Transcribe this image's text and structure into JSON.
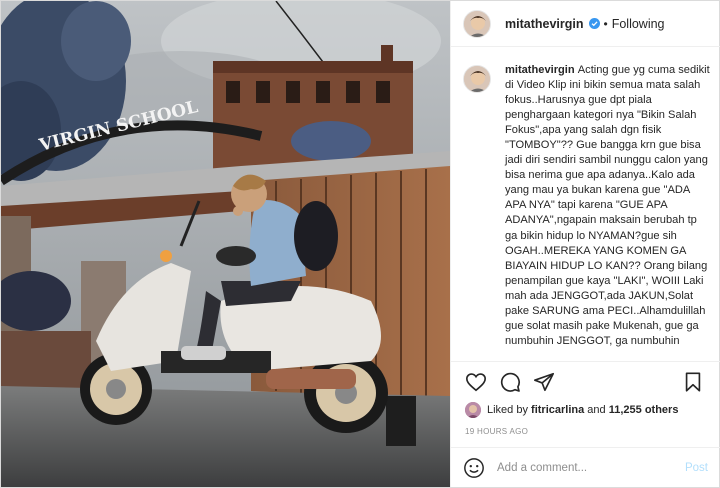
{
  "post": {
    "username": "mitathevirgin",
    "follow_label": "Following",
    "separator": "•",
    "caption_username": "mitathevirgin",
    "caption_text": "Acting gue yg cuma sedikit di Video Klip ini bikin semua mata salah fokus..Harusnya gue dpt piala penghargaan kategori nya \"Bikin Salah Fokus\",apa yang salah dgn fisik \"TOMBOY\"?? Gue bangga krn gue bisa jadi diri sendiri sambil nunggu calon yang bisa nerima gue apa adanya..Kalo ada yang mau ya bukan karena gue \"ADA APA NYA\" tapi karena \"GUE APA ADANYA\",ngapain maksain berubah tp ga bikin hidup lo NYAMAN?gue sih OGAH..MEREKA YANG KOMEN GA BIAYAIN HIDUP LO KAN?? Orang bilang penampilan gue kaya \"LAKI\", WOIII Laki mah ada JENGGOT,ada JAKUN,Solat pake SARUNG ama PECI..Alhamdulillah gue solat masih pake Mukenah, gue ga numbuhin JENGGOT, ga numbuhin",
    "liked_by_prefix": "Liked by",
    "liked_by_user": "fitricarlina",
    "liked_by_and": "and",
    "liked_by_count": "11,255 others",
    "timestamp": "19 HOURS AGO",
    "comment_placeholder": "Add a comment...",
    "post_button": "Post",
    "photo_sign_text": "VIRGIN SCHOOL"
  },
  "icons": {
    "verified": "verified-badge-icon",
    "like": "heart-icon",
    "comment": "comment-icon",
    "share": "paper-plane-icon",
    "save": "bookmark-icon",
    "emoji": "smiley-icon"
  },
  "colors": {
    "verified_blue": "#3897f0",
    "post_button_disabled": "#b2dffc",
    "muted_text": "#8e8e8e",
    "border": "#efefef"
  }
}
